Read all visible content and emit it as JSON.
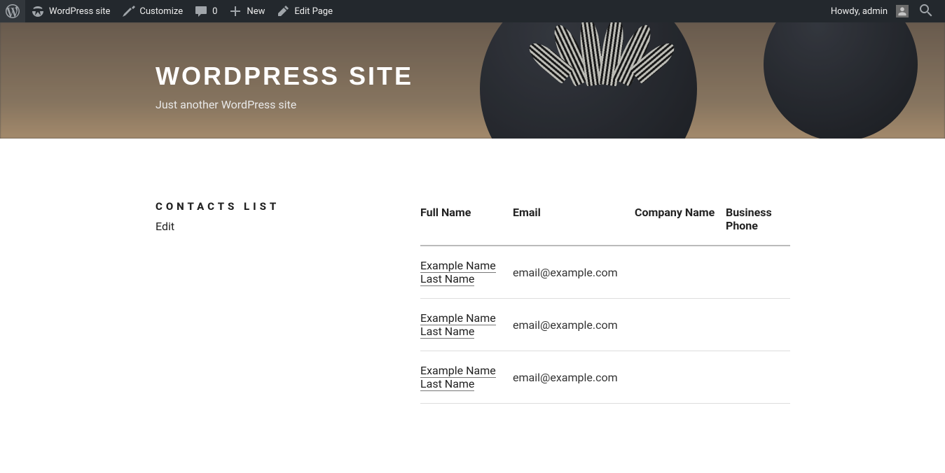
{
  "adminbar": {
    "wp_logo": "W",
    "site_name": "WordPress site",
    "customize": "Customize",
    "comments_count": "0",
    "new": "New",
    "edit_page": "Edit Page",
    "howdy": "Howdy, admin"
  },
  "hero": {
    "title": "WORDPRESS SITE",
    "tagline": "Just another WordPress site"
  },
  "page": {
    "title": "CONTACTS LIST",
    "edit_label": "Edit"
  },
  "table": {
    "headers": {
      "full_name": "Full Name",
      "email": "Email",
      "company": "Company Name",
      "phone": "Business Phone"
    },
    "rows": [
      {
        "full_name": "Example Name Last Name",
        "email": "email@example.com",
        "company": "",
        "phone": ""
      },
      {
        "full_name": "Example Name Last Name",
        "email": "email@example.com",
        "company": "",
        "phone": ""
      },
      {
        "full_name": "Example Name Last Name",
        "email": "email@example.com",
        "company": "",
        "phone": ""
      }
    ]
  }
}
